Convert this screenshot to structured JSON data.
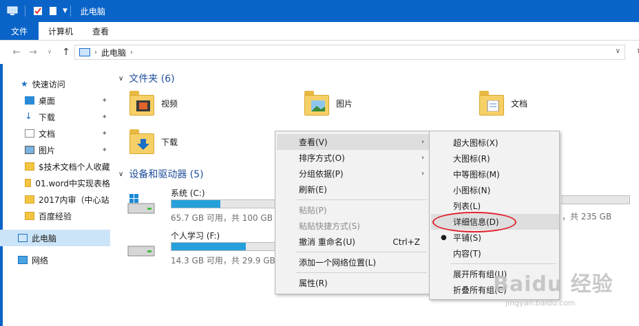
{
  "window": {
    "title": "此电脑"
  },
  "ribbon": {
    "tabs": [
      "文件",
      "计算机",
      "查看"
    ]
  },
  "address": {
    "path": "此电脑"
  },
  "sidebar": {
    "quick_access": "快速访问",
    "items": [
      "桌面",
      "下载",
      "文档",
      "图片",
      "$技术文档个人收藏",
      "01.word中实现表格",
      "2017内审（中心站",
      "百度经验"
    ],
    "this_pc": "此电脑",
    "network": "网络"
  },
  "folders": {
    "title": "文件夹 (6)",
    "items": [
      "视频",
      "图片",
      "文档",
      "下载"
    ]
  },
  "drives": {
    "title": "设备和驱动器 (5)",
    "items": [
      {
        "name": "系统 (C:)",
        "info": "65.7 GB 可用，共 100 GB",
        "used_pct": 34
      },
      {
        "name": "个人学习 (F:)",
        "info": "14.3 GB 可用，共 29.9 GB",
        "used_pct": 52
      }
    ],
    "partial_info": "，共 235 GB"
  },
  "context_menu": {
    "view": "查看(V)",
    "sort": "排序方式(O)",
    "group": "分组依据(P)",
    "refresh": "刷新(E)",
    "paste": "粘贴(P)",
    "paste_shortcut": "粘贴快捷方式(S)",
    "undo": "撤消 重命名(U)",
    "undo_shortcut": "Ctrl+Z",
    "add_network": "添加一个网络位置(L)",
    "properties": "属性(R)"
  },
  "view_submenu": {
    "items": [
      "超大图标(X)",
      "大图标(R)",
      "中等图标(M)",
      "小图标(N)",
      "列表(L)",
      "详细信息(D)",
      "平铺(S)",
      "内容(T)"
    ],
    "expand": "展开所有组(U)",
    "collapse": "折叠所有组(C)"
  },
  "watermark": {
    "main": "Baidu 经验",
    "sub": "jingyan.baidu.com"
  },
  "colors": {
    "accent": "#0a64c8",
    "highlight_ellipse": "#e0202a",
    "drive_fill": "#26a0da"
  }
}
